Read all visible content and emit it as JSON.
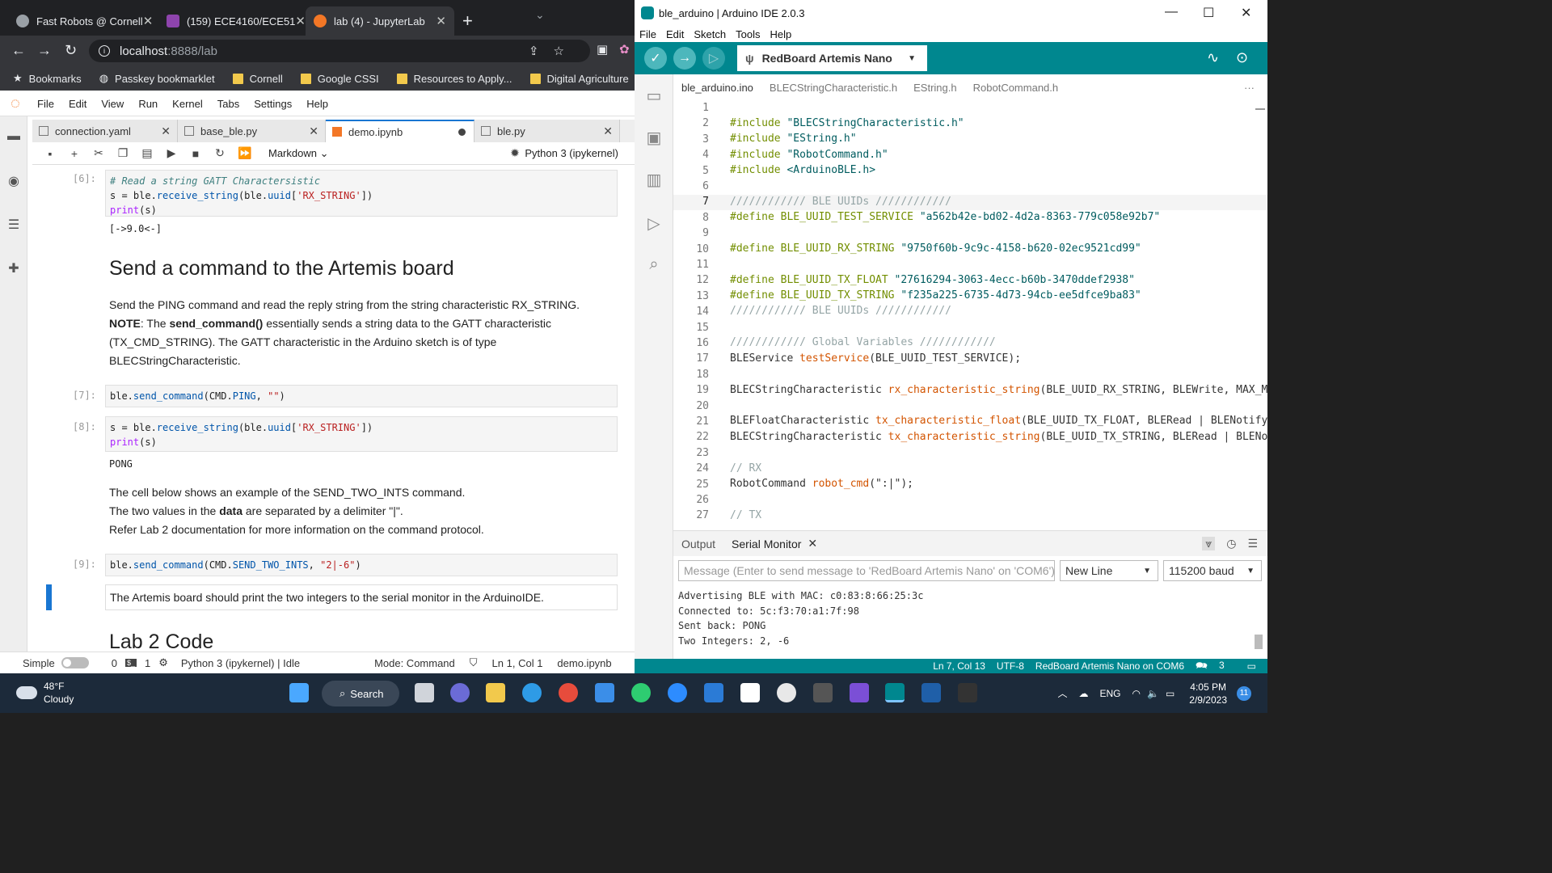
{
  "chrome": {
    "tabs": [
      "Fast Robots @ Cornell",
      "(159) ECE4160/ECE51",
      "lab (4) - JupyterLab"
    ],
    "url_host": "localhost",
    "url_path": ":8888/lab",
    "bookmarks": [
      "Bookmarks",
      "Passkey bookmarklet",
      "Cornell",
      "Google CSSI",
      "Resources to Apply...",
      "Digital Agriculture"
    ]
  },
  "jupyter": {
    "menu": [
      "File",
      "Edit",
      "View",
      "Run",
      "Kernel",
      "Tabs",
      "Settings",
      "Help"
    ],
    "tabs": [
      "connection.yaml",
      "base_ble.py",
      "demo.ipynb",
      "ble.py"
    ],
    "cell_type": "Markdown",
    "kernel": "Python 3 (ipykernel)",
    "cells": {
      "p6": "[6]:",
      "c6_comment": "# Read a string GATT Charactersistic",
      "c6_l2a": "s = ble.",
      "c6_l2b": "receive_string",
      "c6_l2c": "(ble.",
      "c6_l2d": "uuid",
      "c6_l2e": "[",
      "c6_l2f": "'RX_STRING'",
      "c6_l2g": "])",
      "c6_l3a": "print",
      "c6_l3b": "(s)",
      "o6": "[->9.0<-]",
      "h_send": "Send a command to the Artemis board",
      "md1_l1": "Send the PING command and read the reply string from the string characteristic RX_STRING.",
      "md1_note": "NOTE",
      "md1_colon": ": The ",
      "md1_sendcmd": "send_command()",
      "md1_rest": " essentially sends a string data to the GATT characteristic (TX_CMD_STRING). The GATT characteristic in the Arduino sketch is of type BLECStringCharacteristic.",
      "p7": "[7]:",
      "c7a": "ble.",
      "c7b": "send_command",
      "c7c": "(CMD.",
      "c7d": "PING",
      "c7e": ", ",
      "c7f": "\"\"",
      "c7g": ")",
      "p8": "[8]:",
      "o8": "PONG",
      "md2_l1": "The cell below shows an example of the SEND_TWO_INTS command.",
      "md2_l2a": "The two values in the ",
      "md2_l2b": "data",
      "md2_l2c": " are separated by a delimiter \"|\".",
      "md2_l3": "Refer Lab 2 documentation for more information on the command protocol.",
      "p9": "[9]:",
      "c9d": "SEND_TWO_INTS",
      "c9f": "\"2|-6\"",
      "md3": "The Artemis board should print the two integers to the serial monitor in the ArduinoIDE.",
      "h_lab2": "Lab 2 Code"
    },
    "status": {
      "mode_label": "Simple",
      "zero": "0",
      "one": "1",
      "kernel_state": "Python 3 (ipykernel) | Idle",
      "mode": "Mode: Command",
      "pos": "Ln 1, Col 1",
      "file": "demo.ipynb"
    }
  },
  "arduino": {
    "title": "ble_arduino | Arduino IDE 2.0.3",
    "menu": [
      "File",
      "Edit",
      "Sketch",
      "Tools",
      "Help"
    ],
    "board": "RedBoard Artemis Nano",
    "tabs": [
      "ble_arduino.ino",
      "BLECStringCharacteristic.h",
      "EString.h",
      "RobotCommand.h"
    ],
    "line_numbers": [
      "1",
      "2",
      "3",
      "4",
      "5",
      "6",
      "7",
      "8",
      "9",
      "10",
      "11",
      "12",
      "13",
      "14",
      "15",
      "16",
      "17",
      "18",
      "19",
      "20",
      "21",
      "22",
      "23",
      "24",
      "25",
      "26",
      "27"
    ],
    "code": {
      "inc": "#include",
      "l2s": "\"BLECStringCharacteristic.h\"",
      "l3s": "\"EString.h\"",
      "l4s": "\"RobotCommand.h\"",
      "l5s": "<ArduinoBLE.h>",
      "l7": "//////////// BLE UUIDs ////////////",
      "def": "#define",
      "l8n": "BLE_UUID_TEST_SERVICE",
      "l8s": "\"a562b42e-bd02-4d2a-8363-779c058e92b7\"",
      "l10n": "BLE_UUID_RX_STRING",
      "l10s": "\"9750f60b-9c9c-4158-b620-02ec9521cd99\"",
      "l12n": "BLE_UUID_TX_FLOAT",
      "l12s": "\"27616294-3063-4ecc-b60b-3470ddef2938\"",
      "l13n": "BLE_UUID_TX_STRING",
      "l13s": "\"f235a225-6735-4d73-94cb-ee5dfce9ba83\"",
      "l14": "//////////// BLE UUIDs ////////////",
      "l16": "//////////// Global Variables ////////////",
      "l17a": "BLEService ",
      "l17b": "testService",
      "l17c": "(BLE_UUID_TEST_SERVICE);",
      "l19a": "BLECStringCharacteristic ",
      "l19b": "rx_characteristic_string",
      "l19c": "(BLE_UUID_RX_STRING, BLEWrite, MAX_M",
      "l21a": "BLEFloatCharacteristic ",
      "l21b": "tx_characteristic_float",
      "l21c": "(BLE_UUID_TX_FLOAT, BLERead | BLENotify",
      "l22a": "BLECStringCharacteristic ",
      "l22b": "tx_characteristic_string",
      "l22c": "(BLE_UUID_TX_STRING, BLERead | BLENo",
      "l24": "// RX",
      "l25a": "RobotCommand ",
      "l25b": "robot_cmd",
      "l25c": "(\":|\");",
      "l27": "// TX"
    },
    "panel_tabs": [
      "Output",
      "Serial Monitor"
    ],
    "message_placeholder": "Message (Enter to send message to 'RedBoard Artemis Nano' on 'COM6')",
    "line_ending": "New Line",
    "baud": "115200 baud",
    "serial_lines": [
      "Advertising BLE with MAC: c0:83:8:66:25:3c",
      "Connected to: 5c:f3:70:a1:7f:98",
      "Sent back: PONG",
      "Two Integers: 2, -6"
    ],
    "status": {
      "pos": "Ln 7, Col 13",
      "enc": "UTF-8",
      "board": "RedBoard Artemis Nano on COM6",
      "notif": "3"
    }
  },
  "taskbar": {
    "temp": "48°F",
    "weather": "Cloudy",
    "search": "Search",
    "lang": "ENG",
    "time": "4:05 PM",
    "date": "2/9/2023",
    "notif_count": "11"
  },
  "colors": {
    "arduino_teal": "#00878f",
    "jupyter_blue": "#1976d2",
    "chrome_dark": "#202124"
  }
}
